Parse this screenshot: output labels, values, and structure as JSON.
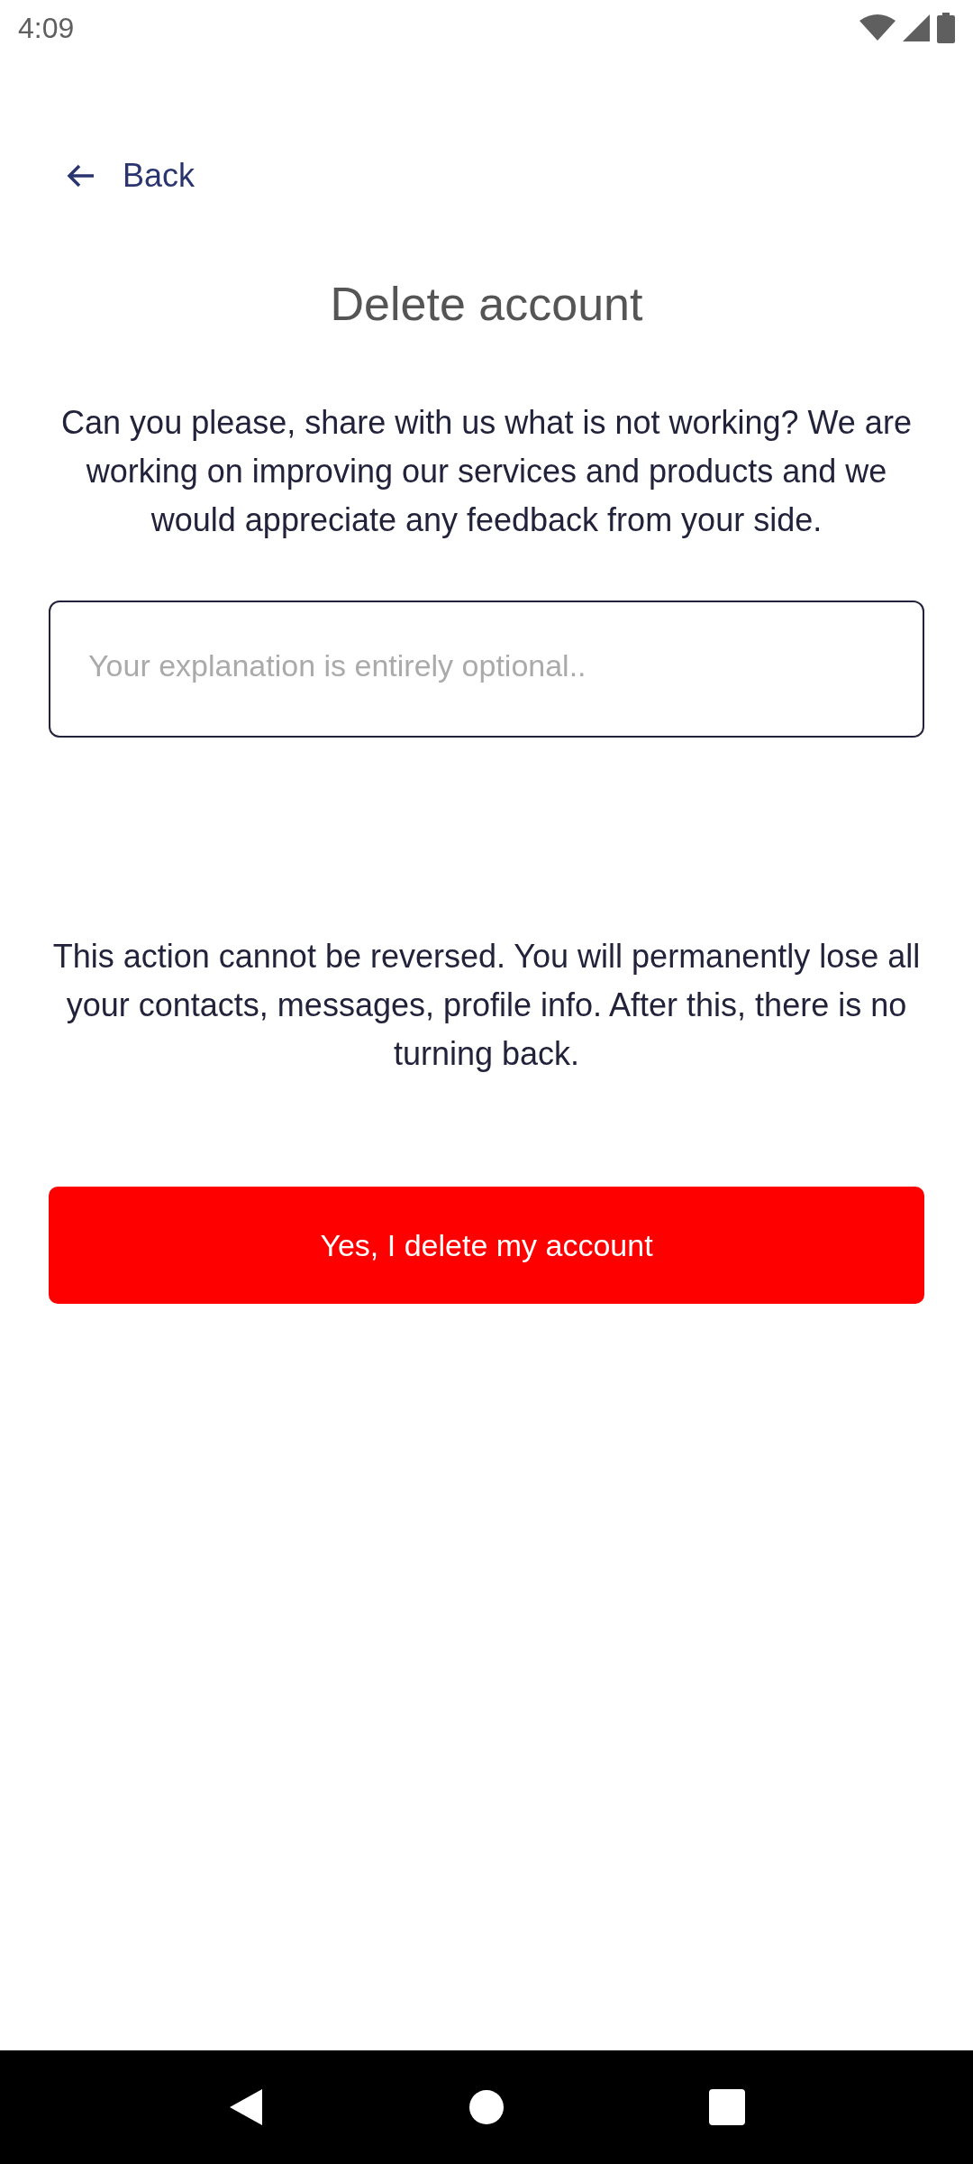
{
  "status_bar": {
    "time": "4:09"
  },
  "back": {
    "label": "Back"
  },
  "title": "Delete account",
  "intro": "Can you please, share with us what is not working? We are working on improving our services and products and we would appreciate any feedback from your side.",
  "feedback": {
    "placeholder": "Your explanation is entirely optional.."
  },
  "warning": "This action cannot be reversed. You will permanently lose all your contacts, messages, profile info. After this, there is no turning back.",
  "delete_button": {
    "label": "Yes, I delete my account"
  }
}
